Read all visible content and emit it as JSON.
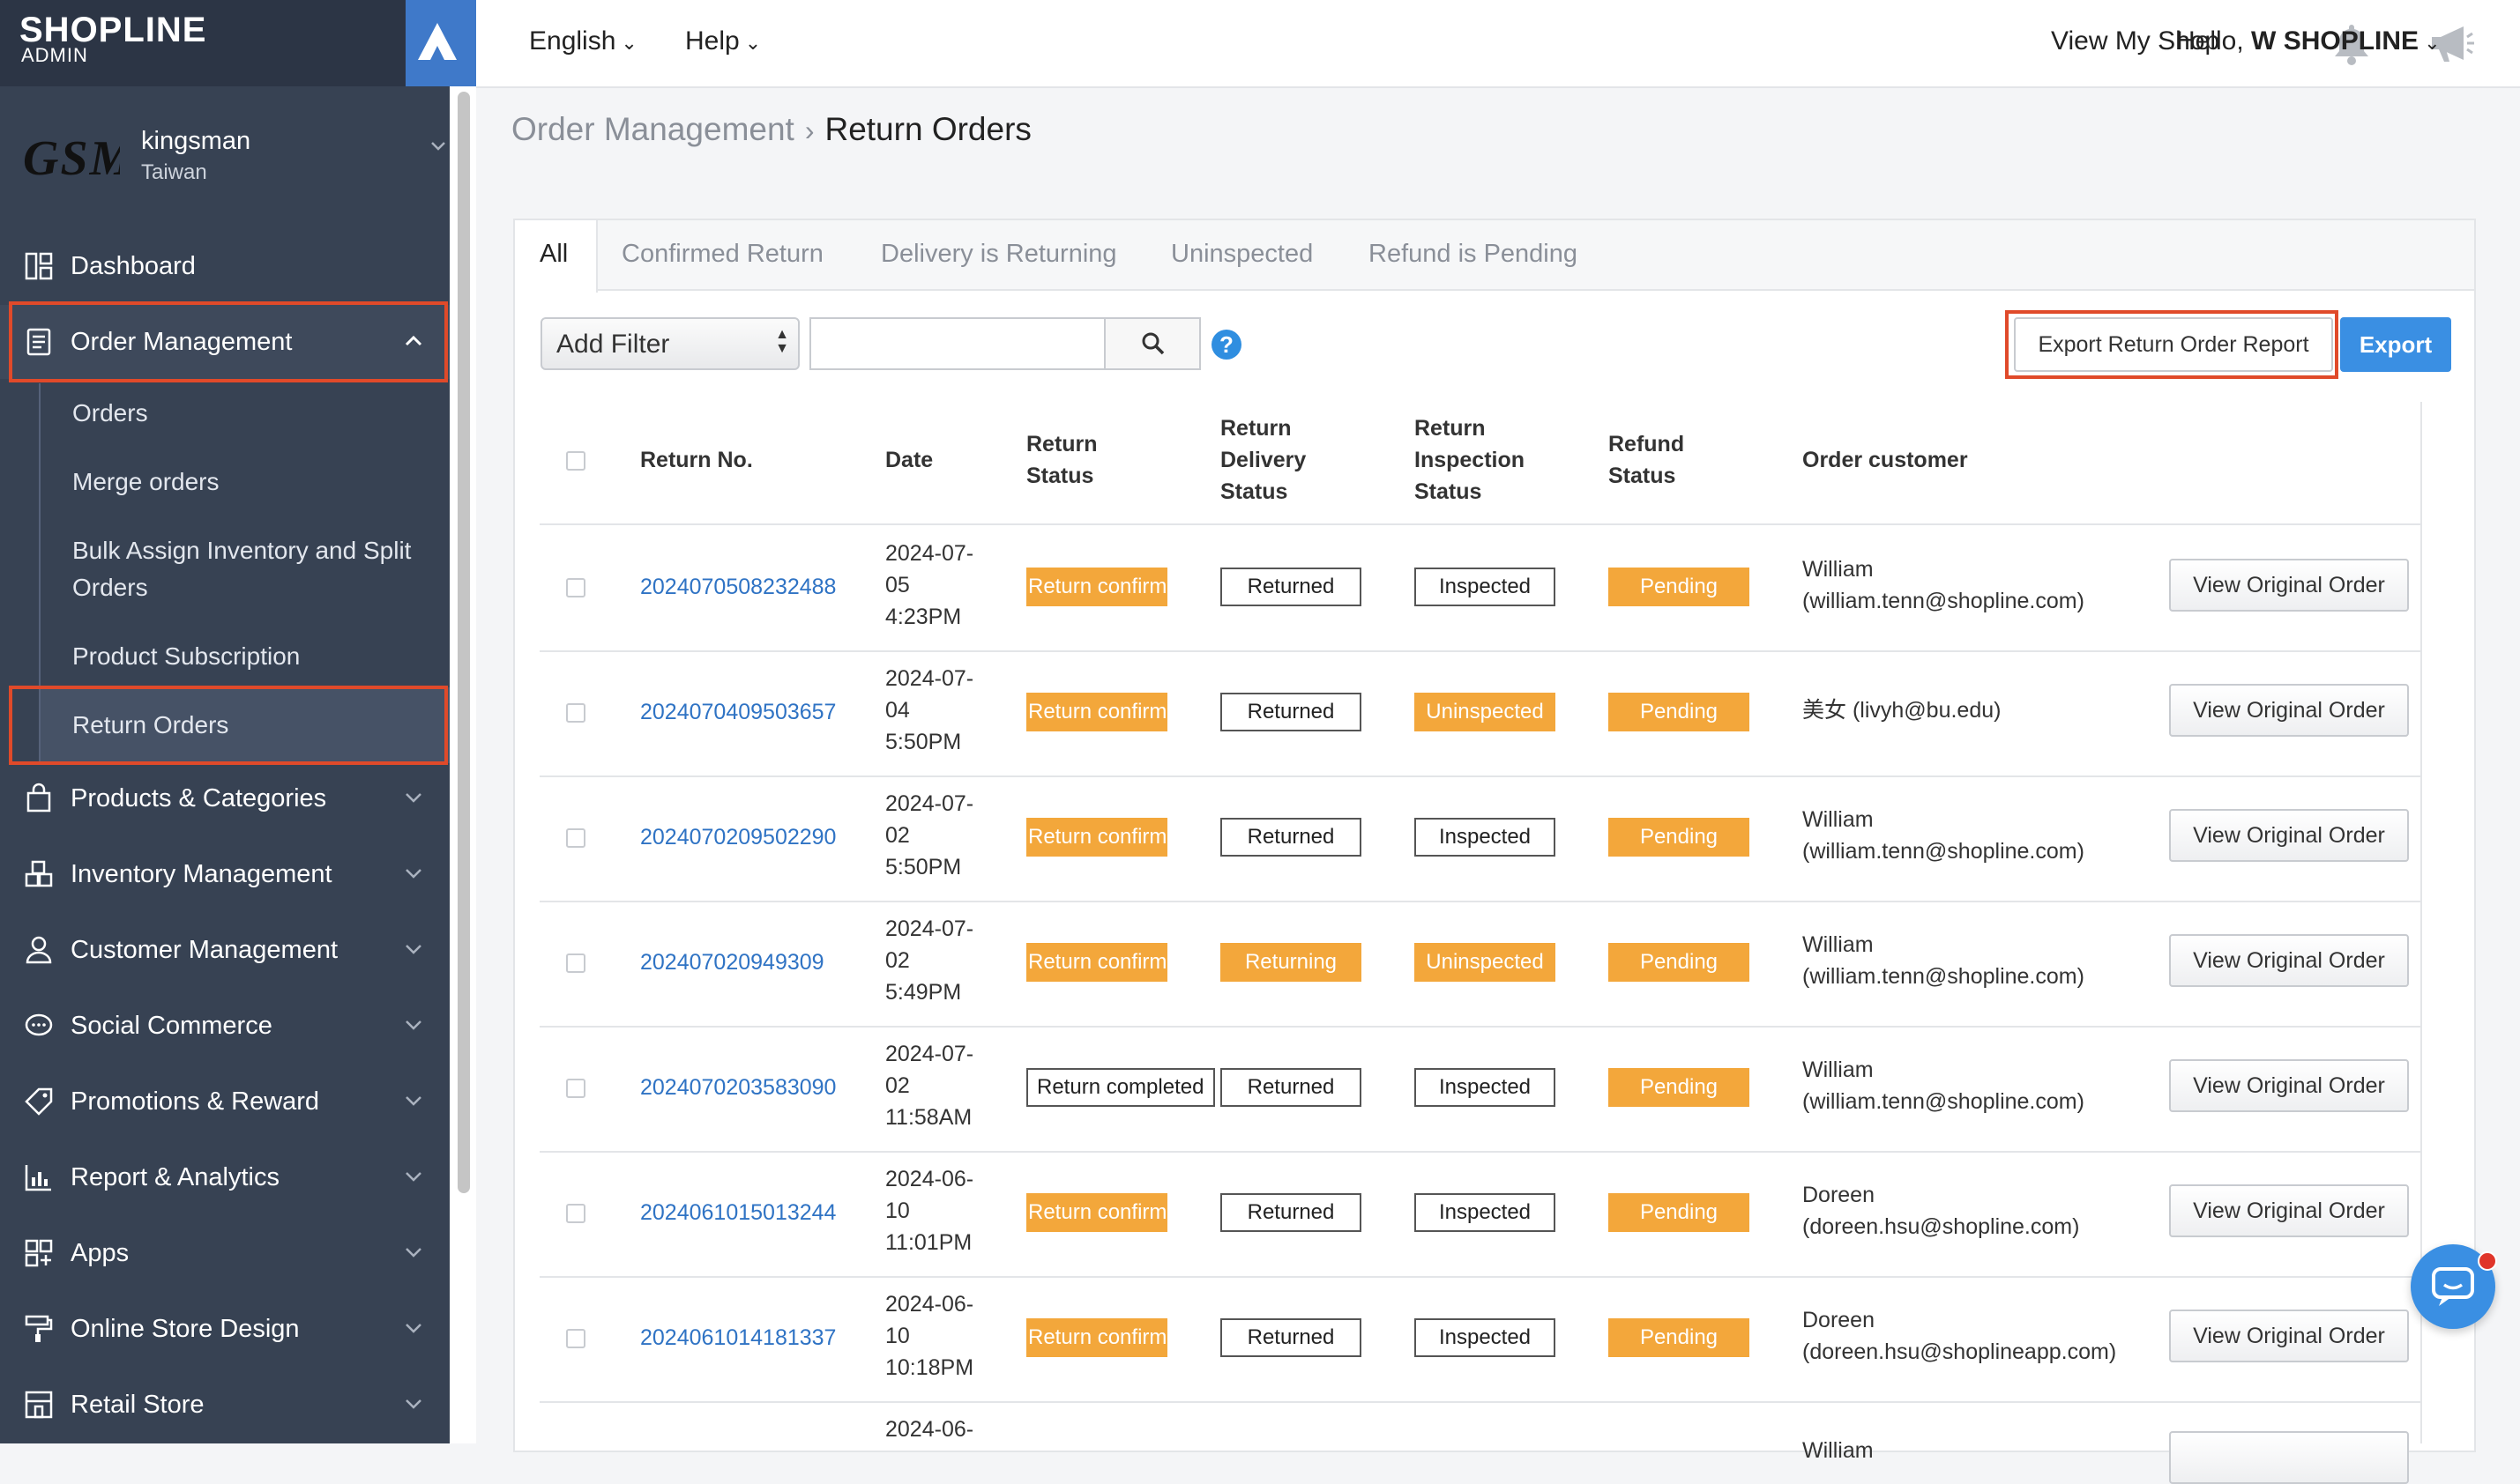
{
  "brand": {
    "name": "SHOPLINE",
    "sub": "ADMIN"
  },
  "shop": {
    "logo_text": "GSM",
    "name": "kingsman",
    "region": "Taiwan"
  },
  "sidebar": {
    "items": [
      {
        "label": "Dashboard",
        "icon": "dashboard-icon"
      },
      {
        "label": "Order Management",
        "icon": "clipboard-icon",
        "expanded": true
      },
      {
        "label": "Products & Categories",
        "icon": "bag-icon"
      },
      {
        "label": "Inventory Management",
        "icon": "boxes-icon"
      },
      {
        "label": "Customer Management",
        "icon": "user-icon"
      },
      {
        "label": "Social Commerce",
        "icon": "chat-icon"
      },
      {
        "label": "Promotions & Reward",
        "icon": "tag-icon"
      },
      {
        "label": "Report & Analytics",
        "icon": "chart-icon"
      },
      {
        "label": "Apps",
        "icon": "apps-icon"
      },
      {
        "label": "Online Store Design",
        "icon": "paint-roller-icon"
      },
      {
        "label": "Retail Store",
        "icon": "store-icon"
      }
    ],
    "sub_items": [
      "Orders",
      "Merge orders",
      "Bulk Assign Inventory and Split Orders",
      "Product Subscription",
      "Return Orders"
    ],
    "active_sub": "Return Orders"
  },
  "topbar": {
    "language": "English",
    "help": "Help",
    "view_shop": "View My Shop",
    "greeting": "Hello,",
    "user": "W SHOPLINE"
  },
  "breadcrumb": {
    "parent": "Order Management",
    "current": "Return Orders"
  },
  "tabs": [
    "All",
    "Confirmed Return",
    "Delivery is Returning",
    "Uninspected",
    "Refund is Pending"
  ],
  "active_tab": "All",
  "filter": {
    "select_label": "Add Filter",
    "search_value": ""
  },
  "actions": {
    "export_report": "Export Return Order Report",
    "export": "Export"
  },
  "table": {
    "headers": {
      "return_no": "Return No.",
      "date": "Date",
      "return_status": [
        "Return",
        "Status"
      ],
      "return_delivery": [
        "Return",
        "Delivery",
        "Status"
      ],
      "return_inspection": [
        "Return",
        "Inspection",
        "Status"
      ],
      "refund_status": [
        "Refund",
        "Status"
      ],
      "order_customer": "Order customer"
    },
    "view_button": "View Original Order",
    "rows": [
      {
        "return_no": "2024070508232488",
        "date": [
          "2024-07-",
          "05",
          "4:23PM"
        ],
        "return_status": "Return confirmed",
        "delivery": "Returned",
        "inspection": "Inspected",
        "refund": "Pending",
        "customer": [
          "William",
          "(william.tenn@shopline.com)"
        ]
      },
      {
        "return_no": "2024070409503657",
        "date": [
          "2024-07-",
          "04",
          "5:50PM"
        ],
        "return_status": "Return confirmed",
        "delivery": "Returned",
        "inspection": "Uninspected",
        "refund": "Pending",
        "customer": [
          "美女 (livyh@bu.edu)",
          ""
        ]
      },
      {
        "return_no": "2024070209502290",
        "date": [
          "2024-07-",
          "02",
          "5:50PM"
        ],
        "return_status": "Return confirmed",
        "delivery": "Returned",
        "inspection": "Inspected",
        "refund": "Pending",
        "customer": [
          "William",
          "(william.tenn@shopline.com)"
        ]
      },
      {
        "return_no": "202407020949309",
        "date": [
          "2024-07-",
          "02",
          "5:49PM"
        ],
        "return_status": "Return confirmed",
        "delivery": "Returning",
        "inspection": "Uninspected",
        "refund": "Pending",
        "customer": [
          "William",
          "(william.tenn@shopline.com)"
        ]
      },
      {
        "return_no": "2024070203583090",
        "date": [
          "2024-07-",
          "02",
          "11:58AM"
        ],
        "return_status": "Return completed",
        "delivery": "Returned",
        "inspection": "Inspected",
        "refund": "Pending",
        "customer": [
          "William",
          "(william.tenn@shopline.com)"
        ]
      },
      {
        "return_no": "2024061015013244",
        "date": [
          "2024-06-",
          "10",
          "11:01PM"
        ],
        "return_status": "Return confirmed",
        "delivery": "Returned",
        "inspection": "Inspected",
        "refund": "Pending",
        "customer": [
          "Doreen",
          "(doreen.hsu@shopline.com)"
        ]
      },
      {
        "return_no": "2024061014181337",
        "date": [
          "2024-06-",
          "10",
          "10:18PM"
        ],
        "return_status": "Return confirmed",
        "delivery": "Returned",
        "inspection": "Inspected",
        "refund": "Pending",
        "customer": [
          "Doreen",
          "(doreen.hsu@shoplineapp.com)"
        ]
      },
      {
        "return_no": "",
        "date": [
          "2024-06-",
          "",
          ""
        ],
        "return_status": "",
        "delivery": "",
        "inspection": "",
        "refund": "",
        "customer": [
          "William",
          ""
        ]
      }
    ]
  },
  "colors": {
    "sidebar_bg": "#374253",
    "accent": "#3a8fe3",
    "highlight": "#e04a2a",
    "badge_orange": "#f3a73b",
    "link": "#2f73c4"
  }
}
